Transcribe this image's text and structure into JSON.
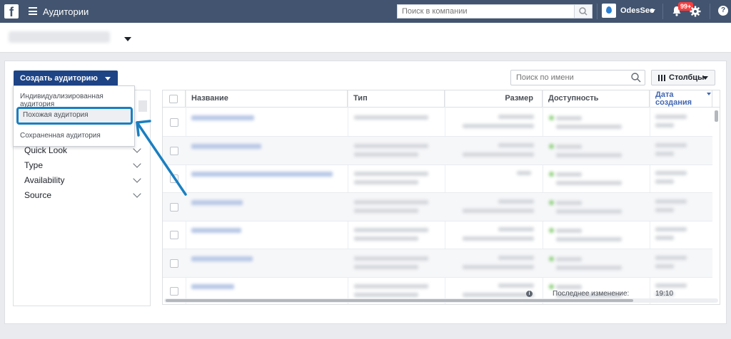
{
  "topbar": {
    "app_title": "Аудитории",
    "company_search_placeholder": "Поиск в компании",
    "business_name": "OdesSeo",
    "notifications_badge": "99+"
  },
  "toolbar": {
    "create_audience_label": "Создать аудиторию",
    "search_name_placeholder": "Поиск по имени",
    "columns_label": "Столбцы"
  },
  "create_menu": {
    "items": [
      "Индивидуализированная аудитория",
      "Похожая аудитория",
      "Сохраненная аудитория"
    ],
    "highlighted_index": 1
  },
  "filters": [
    {
      "label": "Quick Look"
    },
    {
      "label": "Type"
    },
    {
      "label": "Availability"
    },
    {
      "label": "Source"
    }
  ],
  "table": {
    "columns": {
      "name": "Название",
      "type": "Тип",
      "size": "Размер",
      "availability": "Доступность",
      "created": "Дата создания"
    },
    "last_changed_label": "Последнее изменение:",
    "last_row_time": "19:10",
    "row_count": 7
  },
  "colors": {
    "topbar": "#42546f",
    "primary_button": "#1e4486",
    "annotation": "#1a7fc1"
  }
}
